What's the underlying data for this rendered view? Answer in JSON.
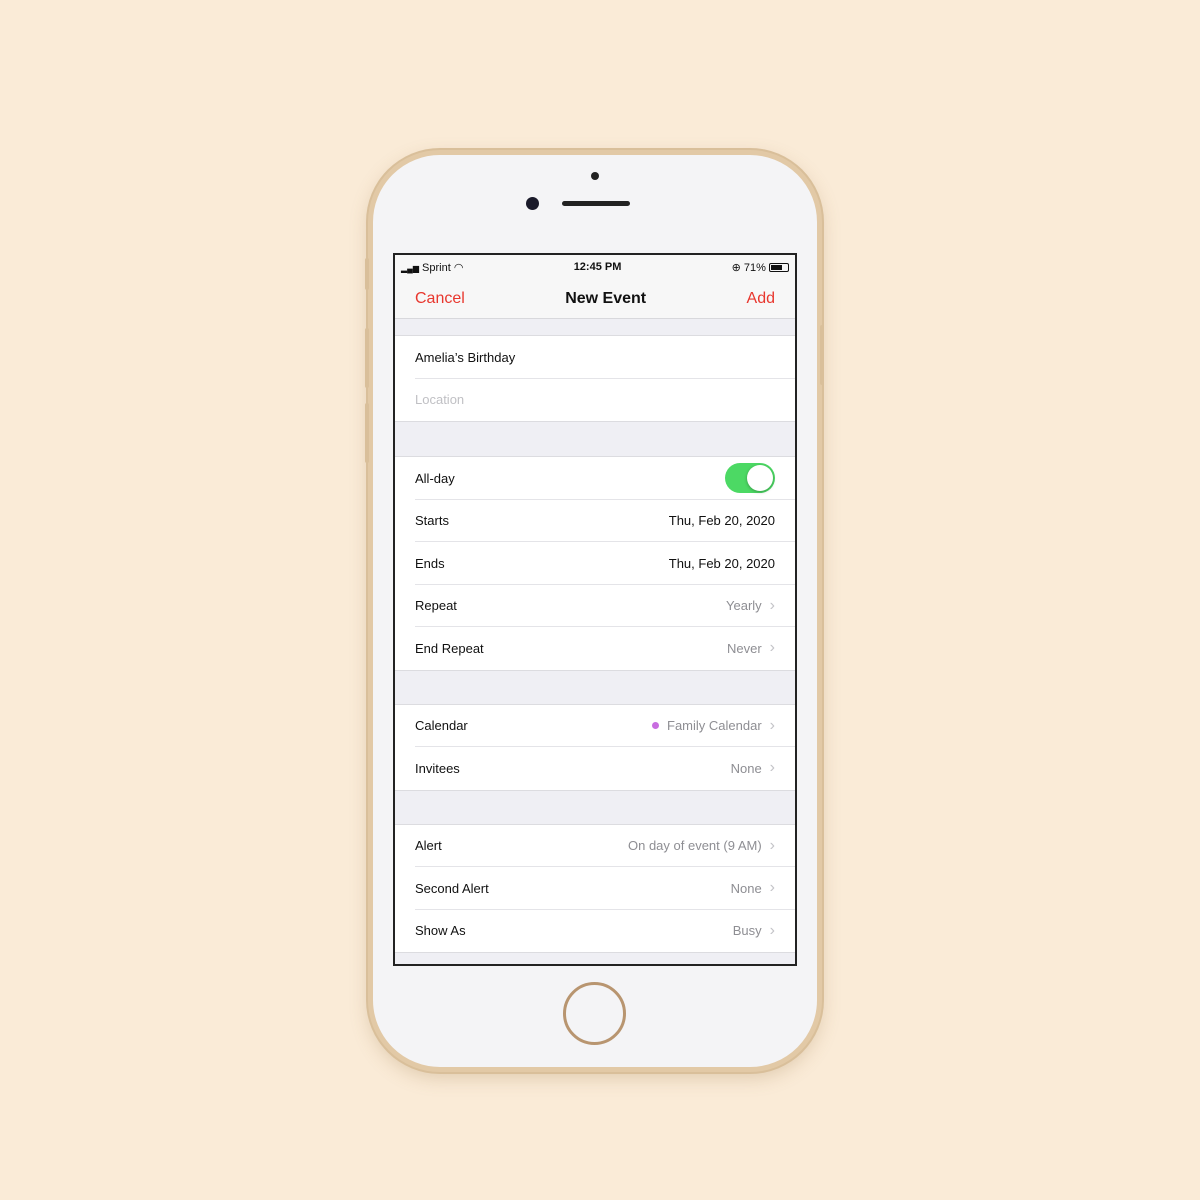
{
  "status": {
    "carrier": "Sprint",
    "time": "12:45 PM",
    "battery": "71%",
    "battery_level": 0.71,
    "icons": [
      "signal-icon",
      "wifi-icon",
      "orientation-lock-icon",
      "battery-icon"
    ]
  },
  "nav": {
    "cancel": "Cancel",
    "title": "New Event",
    "add": "Add",
    "accent": "#e8372e"
  },
  "event": {
    "title": "Amelia’s Birthday",
    "location_placeholder": "Location"
  },
  "rows": {
    "allday": {
      "label": "All-day",
      "on": true
    },
    "starts": {
      "label": "Starts",
      "value": "Thu, Feb 20, 2020"
    },
    "ends": {
      "label": "Ends",
      "value": "Thu, Feb 20, 2020"
    },
    "repeat": {
      "label": "Repeat",
      "value": "Yearly"
    },
    "end_repeat": {
      "label": "End Repeat",
      "value": "Never"
    },
    "calendar": {
      "label": "Calendar",
      "value": "Family Calendar",
      "color": "#c86de0"
    },
    "invitees": {
      "label": "Invitees",
      "value": "None"
    },
    "alert": {
      "label": "Alert",
      "value": "On day of event (9 AM)"
    },
    "second_alert": {
      "label": "Second Alert",
      "value": "None"
    },
    "show_as": {
      "label": "Show As",
      "value": "Busy"
    }
  }
}
